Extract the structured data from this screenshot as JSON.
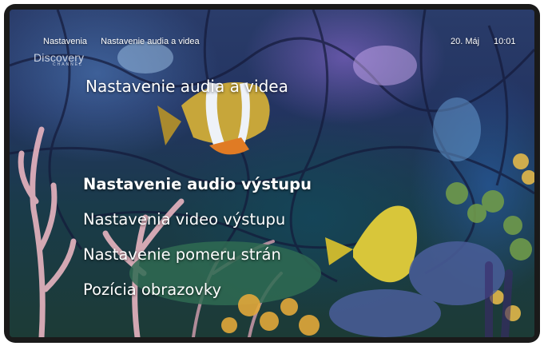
{
  "header": {
    "breadcrumb": [
      "Nastavenia",
      "Nastavenie audia a videa"
    ],
    "date": "20. Máj",
    "time": "10:01"
  },
  "logo": {
    "name": "Discovery",
    "sub": "CHANNEL"
  },
  "page": {
    "title": "Nastavenie audia a videa"
  },
  "menu": {
    "selected_index": 0,
    "items": [
      {
        "label": "Nastavenie audio výstupu"
      },
      {
        "label": "Nastavenia video výstupu"
      },
      {
        "label": "Nastavenie pomeru strán"
      },
      {
        "label": "Pozícia obrazovky"
      }
    ]
  },
  "colors": {
    "text": "#ffffff",
    "frame": "#1a1a1a"
  },
  "background": {
    "description_icon": "aquarium-coral-reef-image"
  }
}
